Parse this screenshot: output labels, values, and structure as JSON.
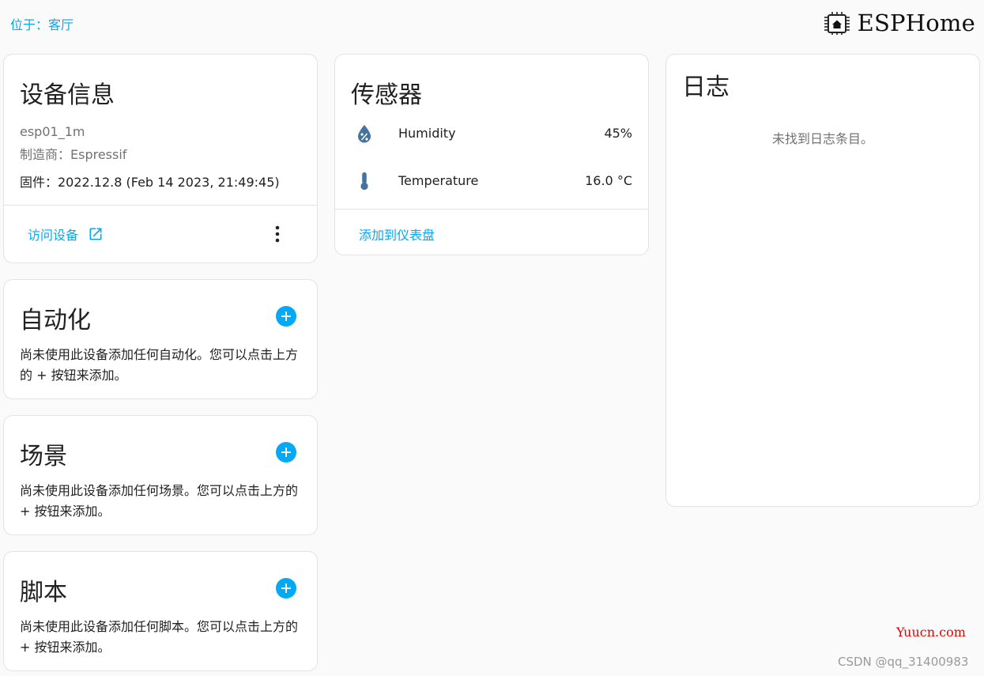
{
  "header": {
    "location": "位于：客厅",
    "logo_text": "ESPHome",
    "logo_icon": "chip-home-icon"
  },
  "device_info": {
    "title": "设备信息",
    "name": "esp01_1m",
    "manufacturer": "制造商：Espressif",
    "firmware": "固件：2022.12.8 (Feb 14 2023, 21:49:45)",
    "visit_label": "访问设备",
    "visit_icon": "open-in-new-icon",
    "menu_icon": "more-vert-icon"
  },
  "automation": {
    "title": "自动化",
    "text": "尚未使用此设备添加任何自动化。您可以点击上方的 + 按钮来添加。"
  },
  "scene": {
    "title": "场景",
    "text": "尚未使用此设备添加任何场景。您可以点击上方的 + 按钮来添加。"
  },
  "script": {
    "title": "脚本",
    "text": "尚未使用此设备添加任何脚本。您可以点击上方的 + 按钮来添加。"
  },
  "sensors": {
    "title": "传感器",
    "items": [
      {
        "name": "Humidity",
        "value": "45%",
        "icon": "water-percent-icon"
      },
      {
        "name": "Temperature",
        "value": "16.0 °C",
        "icon": "thermometer-icon"
      }
    ],
    "add_to_dashboard": "添加到仪表盘"
  },
  "logbook": {
    "title": "日志",
    "empty": "未找到日志条目。"
  },
  "watermark": {
    "site": "Yuucn.com",
    "author": "CSDN @qq_31400983"
  },
  "colors": {
    "accent": "#03a9f4",
    "icon": "#44739e",
    "background": "#fafafa",
    "card": "#ffffff"
  }
}
